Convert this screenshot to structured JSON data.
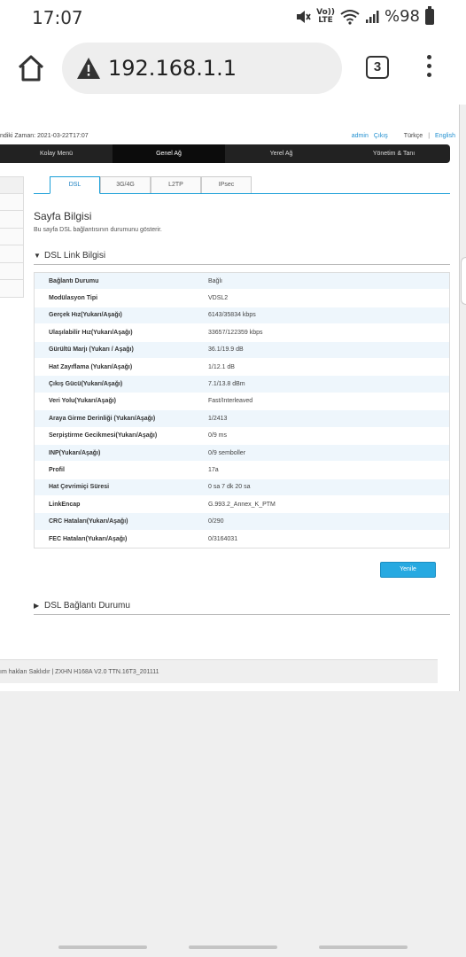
{
  "status_bar": {
    "time": "17:07",
    "battery": "%98",
    "icons": [
      "mute-icon",
      "volte-icon",
      "wifi-icon",
      "signal-icon",
      "battery-icon"
    ],
    "volte_top": "Vo))",
    "volte_bottom": "LTE"
  },
  "browser": {
    "url": "192.168.1.1",
    "tab_count": "3"
  },
  "router": {
    "time_label": "ndiki Zaman: 2021-03-22T17:07",
    "user": "admin",
    "logout": "Çıkış",
    "lang_tr": "Türkçe",
    "lang_sep": "|",
    "lang_en": "English",
    "nav": [
      "Kolay Menü",
      "Genel Ağ",
      "Yerel Ağ",
      "Yönetim & Tanı"
    ],
    "nav_active": 1,
    "subtabs": [
      "DSL",
      "3G/4G",
      "L2TP",
      "IPsec"
    ],
    "subtab_active": 0,
    "page_title": "Sayfa Bilgisi",
    "page_desc": "Bu sayfa DSL bağlantısının durumunu gösterir.",
    "link_section": "DSL Link Bilgisi",
    "rows": [
      {
        "k": "Bağlantı Durumu",
        "v": "Bağlı"
      },
      {
        "k": "Modülasyon Tipi",
        "v": "VDSL2"
      },
      {
        "k": "Gerçek Hız(Yukarı/Aşağı)",
        "v": "6143/35834 kbps"
      },
      {
        "k": "Ulaşılabilir Hız(Yukarı/Aşağı)",
        "v": "33657/122359 kbps"
      },
      {
        "k": "Gürültü Marjı (Yukarı / Aşağı)",
        "v": "36.1/19.9 dB"
      },
      {
        "k": "Hat Zayıflama (Yukarı/Aşağı)",
        "v": "1/12.1 dB"
      },
      {
        "k": "Çıkış Gücü(Yukarı/Aşağı)",
        "v": "7.1/13.8 dBm"
      },
      {
        "k": "Veri Yolu(Yukarı/Aşağı)",
        "v": "Fast/Interleaved"
      },
      {
        "k": "Araya Girme Derinliği (Yukarı/Aşağı)",
        "v": "1/2413"
      },
      {
        "k": "Serpiştirme Gecikmesi(Yukarı/Aşağı)",
        "v": "0/9 ms"
      },
      {
        "k": "INP(Yukarı/Aşağı)",
        "v": "0/9 semboller"
      },
      {
        "k": "Profil",
        "v": "17a"
      },
      {
        "k": "Hat Çevrimiçi Süresi",
        "v": "0 sa 7 dk 20 sa"
      },
      {
        "k": "LinkEncap",
        "v": "G.993.2_Annex_K_PTM"
      },
      {
        "k": "CRC Hataları(Yukarı/Aşağı)",
        "v": "0/290"
      },
      {
        "k": "FEC Hataları(Yukarı/Aşağı)",
        "v": "0/3164031"
      }
    ],
    "refresh": "Yenile",
    "conn_section": "DSL Bağlantı Durumu",
    "footer": "ım hakları Saklıdır  |  ZXHN H168A V2.0 TTN.16T3_201111"
  }
}
